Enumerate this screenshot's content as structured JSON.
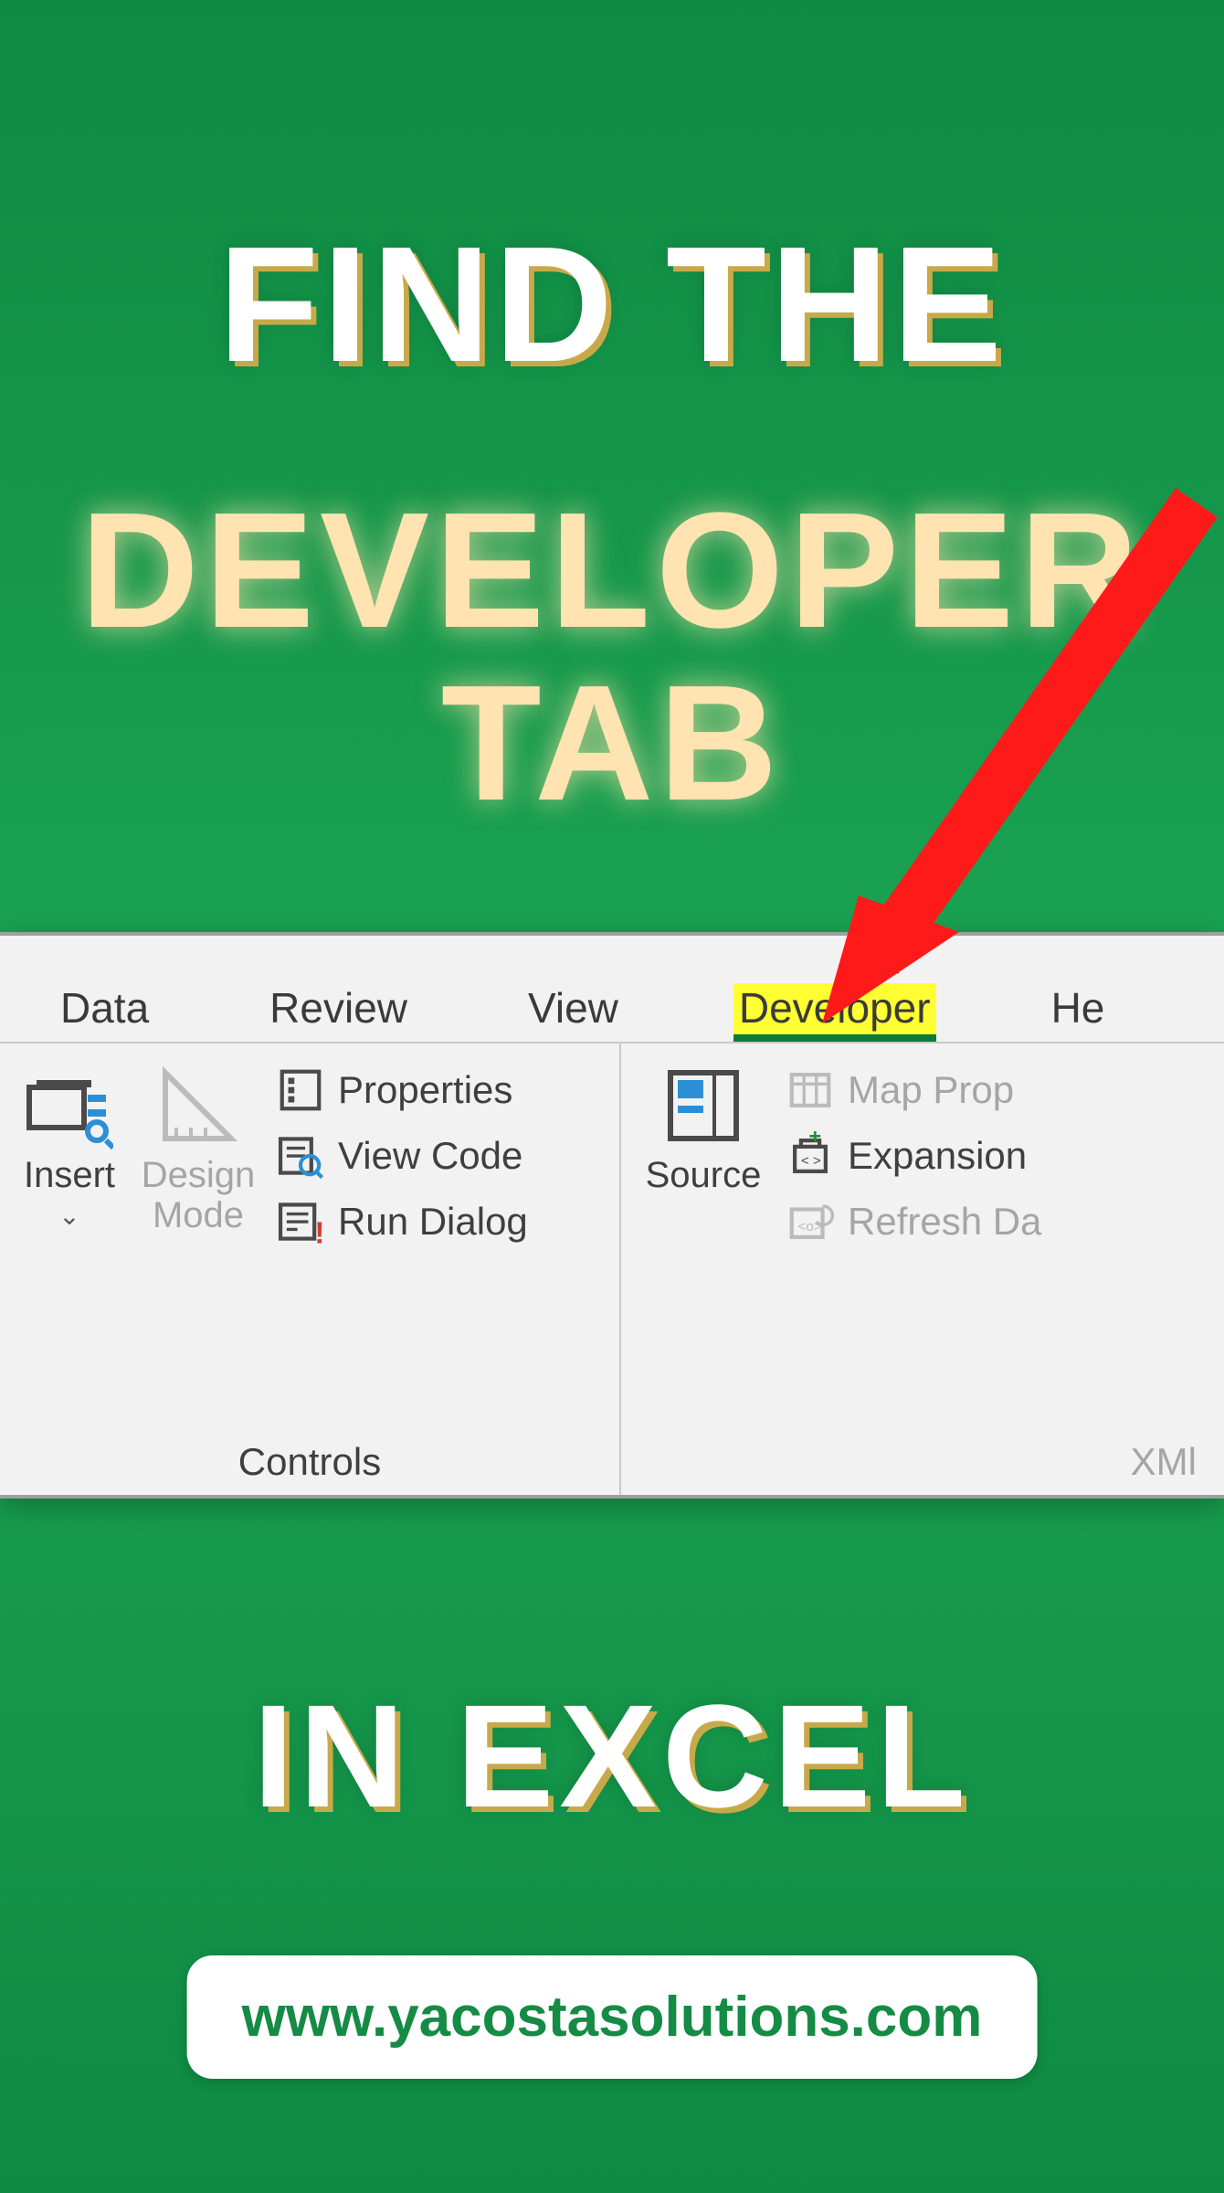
{
  "headline": {
    "top": "FIND THE",
    "mid_line1": "DEVELOPER",
    "mid_line2": "TAB",
    "bottom": "IN EXCEL"
  },
  "url": "www.yacostasolutions.com",
  "ribbon": {
    "tabs": {
      "data": "Data",
      "review": "Review",
      "view": "View",
      "developer": "Developer",
      "help": "He"
    },
    "controls_group": {
      "insert": "Insert",
      "design_line1": "Design",
      "design_line2": "Mode",
      "properties": "Properties",
      "view_code": "View Code",
      "run_dialog": "Run Dialog",
      "label": "Controls"
    },
    "xml_group": {
      "source": "Source",
      "map_properties": "Map Prop",
      "expansion": "Expansion",
      "refresh": "Refresh Da",
      "label": "XMl"
    }
  }
}
